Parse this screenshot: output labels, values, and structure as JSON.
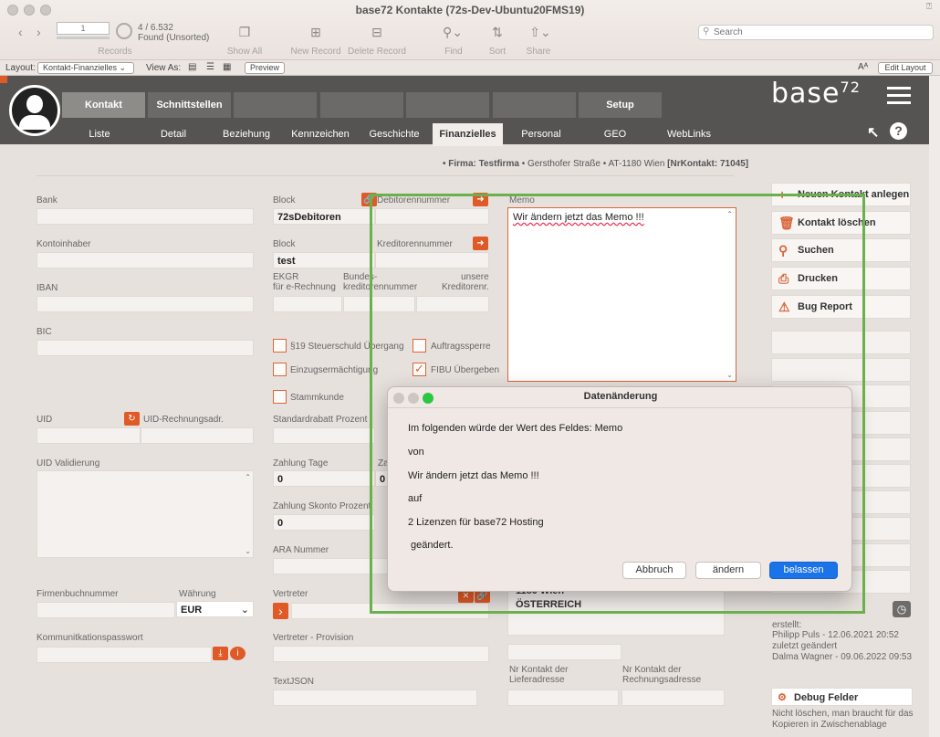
{
  "window": {
    "title": "base72 Kontakte (72s-Dev-Ubuntu20FMS19)"
  },
  "toolbar": {
    "record_input": "1",
    "found": "4 / 6.532",
    "found_sub": "Found (Unsorted)",
    "records_label": "Records",
    "show_all": "Show All",
    "new_record": "New Record",
    "delete_record": "Delete Record",
    "find": "Find",
    "sort": "Sort",
    "share": "Share",
    "search_placeholder": "Search"
  },
  "layoutbar": {
    "layout_label": "Layout:",
    "layout_value": "Kontakt-Finanzielles",
    "view_as": "View As:",
    "preview": "Preview",
    "edit_layout": "Edit Layout",
    "font_glyph": "Aᴬ"
  },
  "header": {
    "brand": "base",
    "brand_sup": "72",
    "tabs_top": [
      "Kontakt",
      "Schnittstellen",
      "",
      "",
      "",
      "",
      "Setup"
    ],
    "tabs_sub": [
      "Liste",
      "Detail",
      "Beziehung",
      "Kennzeichen",
      "Geschichte",
      "Finanzielles",
      "Personal",
      "GEO",
      "WebLinks"
    ],
    "active_sub": "Finanzielles"
  },
  "firm_line": {
    "bullet_firm": "• Firma: Testfirma",
    "address": "• Gersthofer Straße • AT-1180 Wien",
    "nr": "[NrKontakt: 71045]"
  },
  "left": {
    "bank_label": "Bank",
    "kontoinhaber_label": "Kontoinhaber",
    "iban_label": "IBAN",
    "bic_label": "BIC",
    "uid_label": "UID",
    "uid_rechnung_label": "UID-Rechnungsadr.",
    "uid_validierung_label": "UID Validierung",
    "firmenbuch_label": "Firmenbuchnummer",
    "waehrung_label": "Währung",
    "waehrung_value": "EUR",
    "kommpass_label": "Kommunitkationspasswort"
  },
  "middle": {
    "block1_label": "Block",
    "block1_value": "72sDebitoren",
    "debitor_label": "Debitorennummer",
    "block2_label": "Block",
    "block2_value": "test",
    "kreditor_label": "Kreditorennummer",
    "ekgr_label": "EKGR\nfür e-Rechnung",
    "bundes_label": "Bundes-\nkreditorennummer",
    "unsere_label": "unsere\nKreditorenr.",
    "chk1": "§19 Steuerschuld Übergang",
    "chk2": "Auftragssperre",
    "chk3": "Einzugsermächtigung",
    "chk4": "FIBU Übergeben",
    "chk5": "Stammkunde",
    "standardrabatt": "Standardrabatt Prozent",
    "zahlung_tage": "Zahlung Tage",
    "zahlung_tage_value": "0",
    "za_label": "Za",
    "za_value": "0",
    "skonto": "Zahlung Skonto Prozent",
    "skonto_value": "0",
    "ara": "ARA Nummer",
    "vertreter": "Vertreter",
    "vertreter_prov": "Vertreter - Provision",
    "textjson": "TextJSON"
  },
  "memo": {
    "label": "Memo",
    "value": "Wir ändern jetzt das Memo !!!",
    "addr1": "1180 Wien",
    "addr2": "ÖSTERREICH",
    "liefer_label": "Nr Kontakt der\nLieferadresse",
    "rechnung_label": "Nr Kontakt der\nRechnungsadresse"
  },
  "right": {
    "neuen": "Neuen Kontakt anlegen",
    "loeschen": "Kontakt löschen",
    "suchen": "Suchen",
    "drucken": "Drucken",
    "bug": "Bug Report",
    "erstellt": "erstellt:",
    "erstellt_by": "Philipp Puls - 12.06.2021 20:52",
    "geaendert": "zuletzt geändert",
    "geaendert_by": "Dalma Wagner - 09.06.2022 09:53",
    "debug": "Debug Felder",
    "debug_note": "Nicht löschen, man braucht für das Kopieren in Zwischenablage"
  },
  "dialog": {
    "title": "Datenänderung",
    "line1": "Im folgenden würde der Wert des Feldes: Memo",
    "line2": "von",
    "line3": "Wir ändern jetzt das Memo !!!",
    "line4": "auf",
    "line5": "2 Lizenzen für base72 Hosting",
    "line6": " geändert.",
    "btn_abbruch": "Abbruch",
    "btn_aendern": "ändern",
    "btn_belassen": "belassen"
  },
  "colors": {
    "accent": "#e05a27",
    "highlight": "#6ab04c",
    "primary_button": "#1a73e8"
  }
}
